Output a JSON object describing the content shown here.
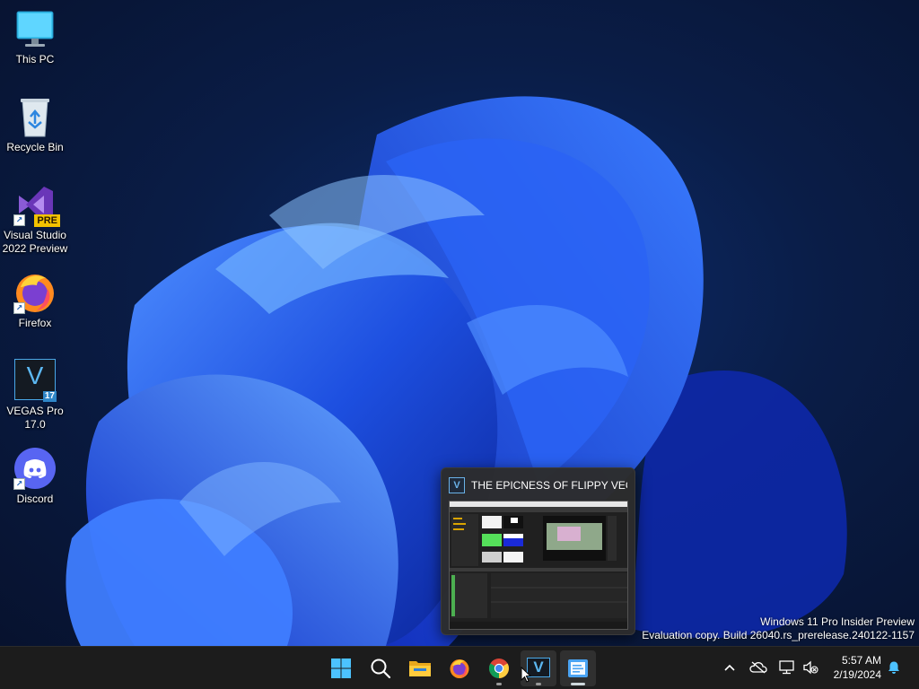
{
  "desktop": {
    "icons": [
      {
        "label": "This PC"
      },
      {
        "label": "Recycle Bin"
      },
      {
        "label_line1": "Visual Studio",
        "label_line2": "2022 Preview",
        "badge": "PRE"
      },
      {
        "label": "Firefox"
      },
      {
        "label_line1": "VEGAS Pro",
        "label_line2": "17.0",
        "mark": "V",
        "version": "17"
      },
      {
        "label": "Discord"
      }
    ]
  },
  "watermark": {
    "line1": "Windows 11 Pro Insider Preview",
    "line2": "Evaluation copy. Build 26040.rs_prerelease.240122-1157"
  },
  "thumbnail": {
    "app_mark": "V",
    "title": "THE EPICNESS OF FLIPPY VEG F..."
  },
  "taskbar": {
    "apps": [
      "start-icon",
      "search-icon",
      "file-explorer-icon",
      "firefox-icon",
      "chrome-icon",
      "vegas-pro-icon",
      "notepad-icon"
    ],
    "vegas_mark": "V"
  },
  "tray": {
    "icons": [
      "chevron-up-icon",
      "onedrive-offline-icon",
      "network-icon",
      "volume-muted-icon",
      "notification-bell-icon"
    ]
  },
  "clock": {
    "time": "5:57 AM",
    "date": "2/19/2024"
  },
  "colors": {
    "accent": "#1f6fe8",
    "taskbar": "#1c1c1c",
    "wallpaper_dark": "#07122e"
  }
}
